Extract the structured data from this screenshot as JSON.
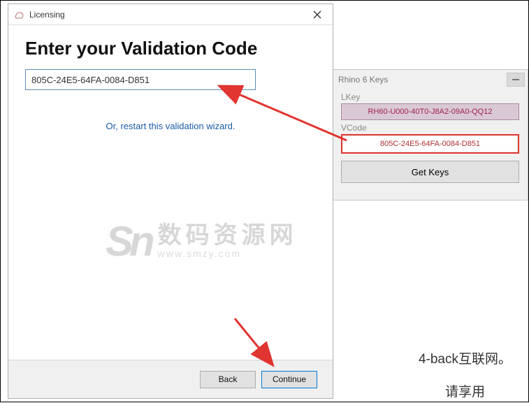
{
  "licensing": {
    "title": "Licensing",
    "heading": "Enter your Validation Code",
    "code_value": "805C-24E5-64FA-0084-D851",
    "restart_text": "Or, restart this validation wizard.",
    "back_label": "Back",
    "continue_label": "Continue"
  },
  "keygen": {
    "title": "Rhino 6 Keys",
    "lkey_label": "LKey",
    "lkey_value": "RH60-U000-40T0-J8A2-09A0-QQ12",
    "vcode_label": "VCode",
    "vcode_value": "805C-24E5-64FA-0084-D851",
    "get_keys_label": "Get Keys"
  },
  "watermark": {
    "logo": "Sn",
    "cn": "数码资源网",
    "url": "www.smzy.com"
  },
  "background_page": {
    "line1": "4-back互联网。",
    "line2": "请享用"
  },
  "colors": {
    "arrow": "#e03530",
    "link": "#1a5aa8"
  }
}
